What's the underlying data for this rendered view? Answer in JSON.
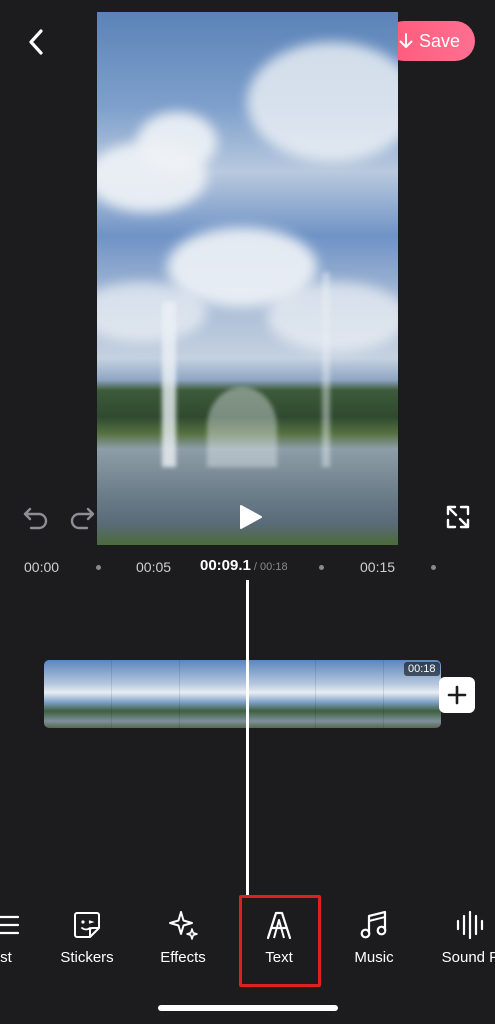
{
  "header": {
    "back_icon": "chevron-left-icon",
    "save_label": "Save",
    "save_icon": "arrow-down-icon",
    "save_color": "#ff5f82"
  },
  "player": {
    "play_icon": "play-icon",
    "undo_icon": "undo-icon",
    "redo_icon": "redo-icon",
    "fullscreen_icon": "fullscreen-icon"
  },
  "timeline": {
    "ticks": [
      "00:00",
      "00:05",
      "00:15"
    ],
    "current_time": "00:09.1",
    "total_time": " / 00:18",
    "clip_duration": "00:18",
    "add_clip_icon": "plus-icon"
  },
  "toolbar": {
    "items": [
      {
        "label": "st",
        "icon": "list-icon"
      },
      {
        "label": "Stickers",
        "icon": "sticker-icon"
      },
      {
        "label": "Effects",
        "icon": "sparkle-icon"
      },
      {
        "label": "Text",
        "icon": "text-a-icon"
      },
      {
        "label": "Music",
        "icon": "music-note-icon"
      },
      {
        "label": "Sound F",
        "icon": "sound-wave-icon"
      }
    ],
    "highlight_color": "#e02020"
  }
}
